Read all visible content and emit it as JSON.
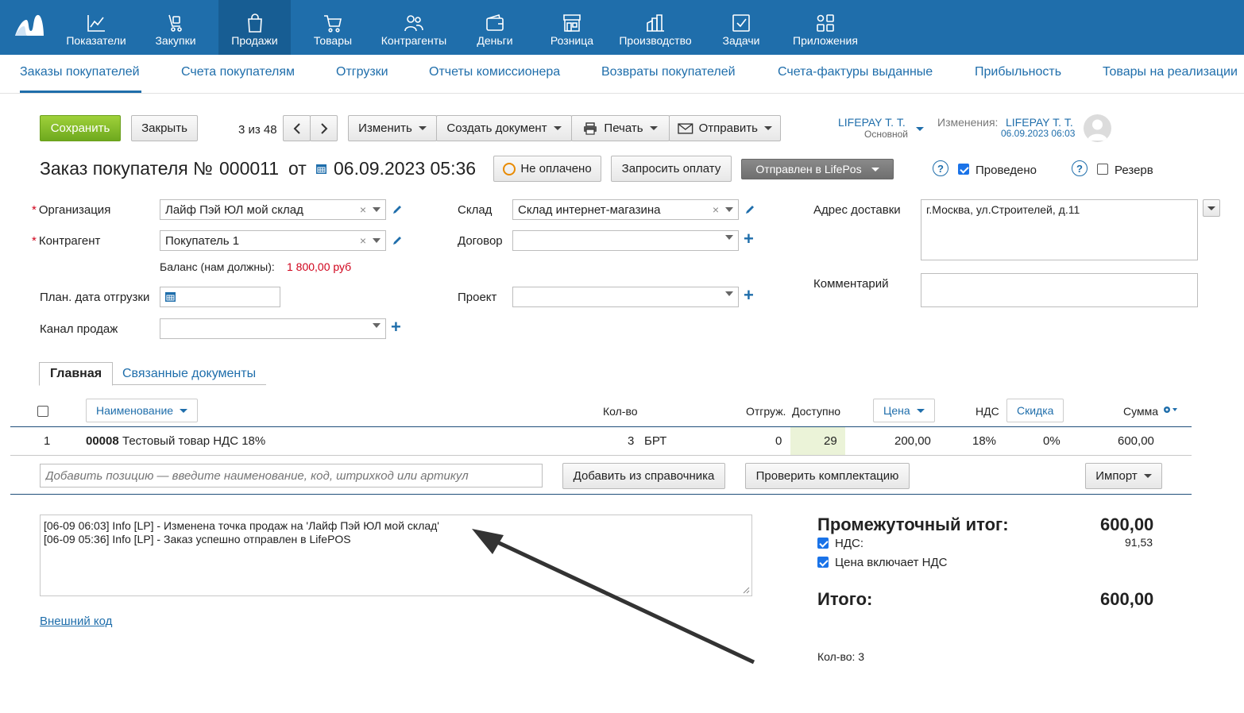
{
  "topnav": {
    "items": [
      {
        "label": "Показатели",
        "icon": "chart-line-icon"
      },
      {
        "label": "Закупки",
        "icon": "cart-hand-icon"
      },
      {
        "label": "Продажи",
        "icon": "shopping-bag-icon",
        "active": true
      },
      {
        "label": "Товары",
        "icon": "shopping-cart-icon"
      },
      {
        "label": "Контрагенты",
        "icon": "people-icon"
      },
      {
        "label": "Деньги",
        "icon": "wallet-icon"
      },
      {
        "label": "Розница",
        "icon": "store-icon"
      },
      {
        "label": "Производство",
        "icon": "factory-icon"
      },
      {
        "label": "Задачи",
        "icon": "checkbox-icon"
      },
      {
        "label": "Приложения",
        "icon": "apps-icon"
      }
    ],
    "colors": {
      "bg": "#1f6eab",
      "active": "#175d93"
    }
  },
  "subnav": {
    "items": [
      "Заказы покупателей",
      "Счета покупателям",
      "Отгрузки",
      "Отчеты комиссионера",
      "Возвраты покупателей",
      "Счета-фактуры выданные",
      "Прибыльность",
      "Товары на реализации"
    ]
  },
  "toolbar": {
    "save": "Сохранить",
    "close": "Закрыть",
    "pager": "3 из 48",
    "edit": "Изменить",
    "create_doc": "Создать документ",
    "print": "Печать",
    "send": "Отправить"
  },
  "user": {
    "name": "LIFEPAY Т. Т.",
    "role": "Основной",
    "changes_label": "Изменения:",
    "changes_user": "LIFEPAY Т. Т.",
    "changes_date": "06.09.2023 06:03"
  },
  "doc": {
    "title": "Заказ покупателя №",
    "number": "000011",
    "from": "от",
    "date": "06.09.2023 05:36",
    "payment_status": "Не оплачено",
    "request_payment": "Запросить оплату",
    "sent_status": "Отправлен в LifePos",
    "posted_label": "Проведено",
    "reserve_label": "Резерв"
  },
  "form": {
    "org_label": "Организация",
    "org_value": "Лайф Пэй ЮЛ мой склад",
    "counterparty_label": "Контрагент",
    "counterparty_value": "Покупатель 1",
    "balance_label": "Баланс (нам должны):",
    "balance_value": "1 800,00 руб",
    "ship_date_label": "План. дата отгрузки",
    "channel_label": "Канал продаж",
    "warehouse_label": "Склад",
    "warehouse_value": "Склад интернет-магазина",
    "contract_label": "Договор",
    "project_label": "Проект",
    "address_label": "Адрес доставки",
    "address_value": "г.Москва, ул.Строителей, д.11",
    "comment_label": "Комментарий"
  },
  "tabs": [
    "Главная",
    "Связанные документы"
  ],
  "table": {
    "headers": {
      "name": "Наименование",
      "qty": "Кол-во",
      "shipped": "Отгруж.",
      "available": "Доступно",
      "price": "Цена",
      "vat": "НДС",
      "discount": "Скидка",
      "sum": "Сумма"
    },
    "rows": [
      {
        "index": "1",
        "code": "00008",
        "name": "Тестовый товар НДС 18%",
        "qty": "3",
        "unit": "БРТ",
        "shipped": "0",
        "available": "29",
        "price": "200,00",
        "vat": "18%",
        "discount": "0%",
        "sum": "600,00"
      }
    ],
    "add_placeholder": "Добавить позицию — введите наименование, код, штрихкод или артикул",
    "add_from_catalog": "Добавить из справочника",
    "check_kit": "Проверить комплектацию",
    "import": "Импорт"
  },
  "log": {
    "lines": [
      "[06-09 06:03] Info [LP] - Изменена точка продаж на 'Лайф Пэй ЮЛ мой склад'",
      "[06-09 05:36] Info [LP] - Заказ успешно отправлен в LifePOS"
    ]
  },
  "external_code": "Внешний код",
  "totals": {
    "subtotal_label": "Промежуточный итог:",
    "subtotal_value": "600,00",
    "vat_label": "НДС:",
    "vat_value": "91,53",
    "price_incl_vat": "Цена включает НДС",
    "total_label": "Итого:",
    "total_value": "600,00",
    "qty_label": "Кол-во: 3"
  }
}
